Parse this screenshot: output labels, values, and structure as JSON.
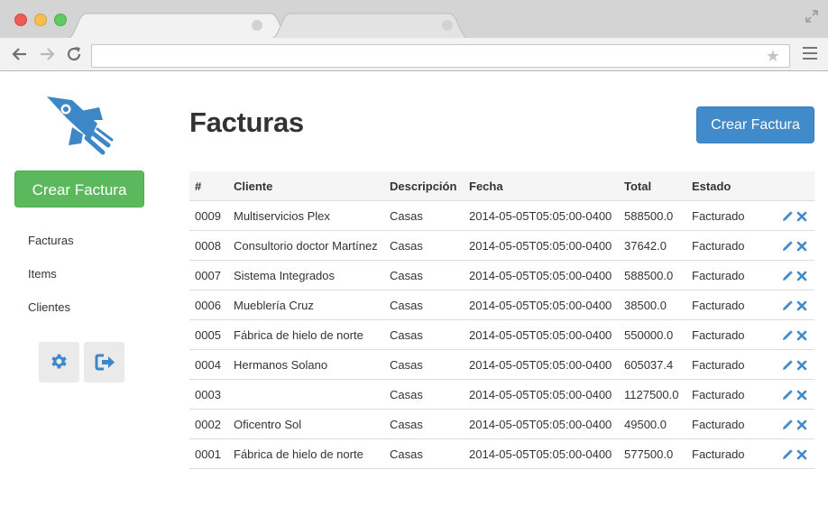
{
  "browser": {
    "url": "",
    "star_glyph": "★"
  },
  "sidebar": {
    "logo_icon": "rocket-icon",
    "create_label": "Crear Factura",
    "nav": [
      "Facturas",
      "Items",
      "Clientes"
    ],
    "settings_icon": "gear-icon",
    "logout_icon": "sign-out-icon"
  },
  "main": {
    "title": "Facturas",
    "create_label": "Crear Factura",
    "table": {
      "headers": [
        "#",
        "Cliente",
        "Descripción",
        "Fecha",
        "Total",
        "Estado",
        ""
      ],
      "rows": [
        {
          "id": "0009",
          "cliente": "Multiservicios Plex",
          "descripcion": "Casas",
          "fecha": "2014-05-05T05:05:00-0400",
          "total": "588500.0",
          "estado": "Facturado"
        },
        {
          "id": "0008",
          "cliente": "Consultorio doctor Martínez",
          "descripcion": "Casas",
          "fecha": "2014-05-05T05:05:00-0400",
          "total": "37642.0",
          "estado": "Facturado"
        },
        {
          "id": "0007",
          "cliente": "Sistema Integrados",
          "descripcion": "Casas",
          "fecha": "2014-05-05T05:05:00-0400",
          "total": "588500.0",
          "estado": "Facturado"
        },
        {
          "id": "0006",
          "cliente": "Mueblería Cruz",
          "descripcion": "Casas",
          "fecha": "2014-05-05T05:05:00-0400",
          "total": "38500.0",
          "estado": "Facturado"
        },
        {
          "id": "0005",
          "cliente": "Fábrica de hielo de norte",
          "descripcion": "Casas",
          "fecha": "2014-05-05T05:05:00-0400",
          "total": "550000.0",
          "estado": "Facturado"
        },
        {
          "id": "0004",
          "cliente": "Hermanos Solano",
          "descripcion": "Casas",
          "fecha": "2014-05-05T05:05:00-0400",
          "total": "605037.4",
          "estado": "Facturado"
        },
        {
          "id": "0003",
          "cliente": "",
          "descripcion": "Casas",
          "fecha": "2014-05-05T05:05:00-0400",
          "total": "1127500.0",
          "estado": "Facturado"
        },
        {
          "id": "0002",
          "cliente": "Oficentro Sol",
          "descripcion": "Casas",
          "fecha": "2014-05-05T05:05:00-0400",
          "total": "49500.0",
          "estado": "Facturado"
        },
        {
          "id": "0001",
          "cliente": "Fábrica de hielo de norte",
          "descripcion": "Casas",
          "fecha": "2014-05-05T05:05:00-0400",
          "total": "577500.0",
          "estado": "Facturado"
        }
      ],
      "row_actions": [
        "pencil-icon",
        "remove-icon"
      ]
    }
  },
  "colors": {
    "primary": "#428bca",
    "success": "#5cb85c",
    "brand_icon": "#3d87c9"
  }
}
